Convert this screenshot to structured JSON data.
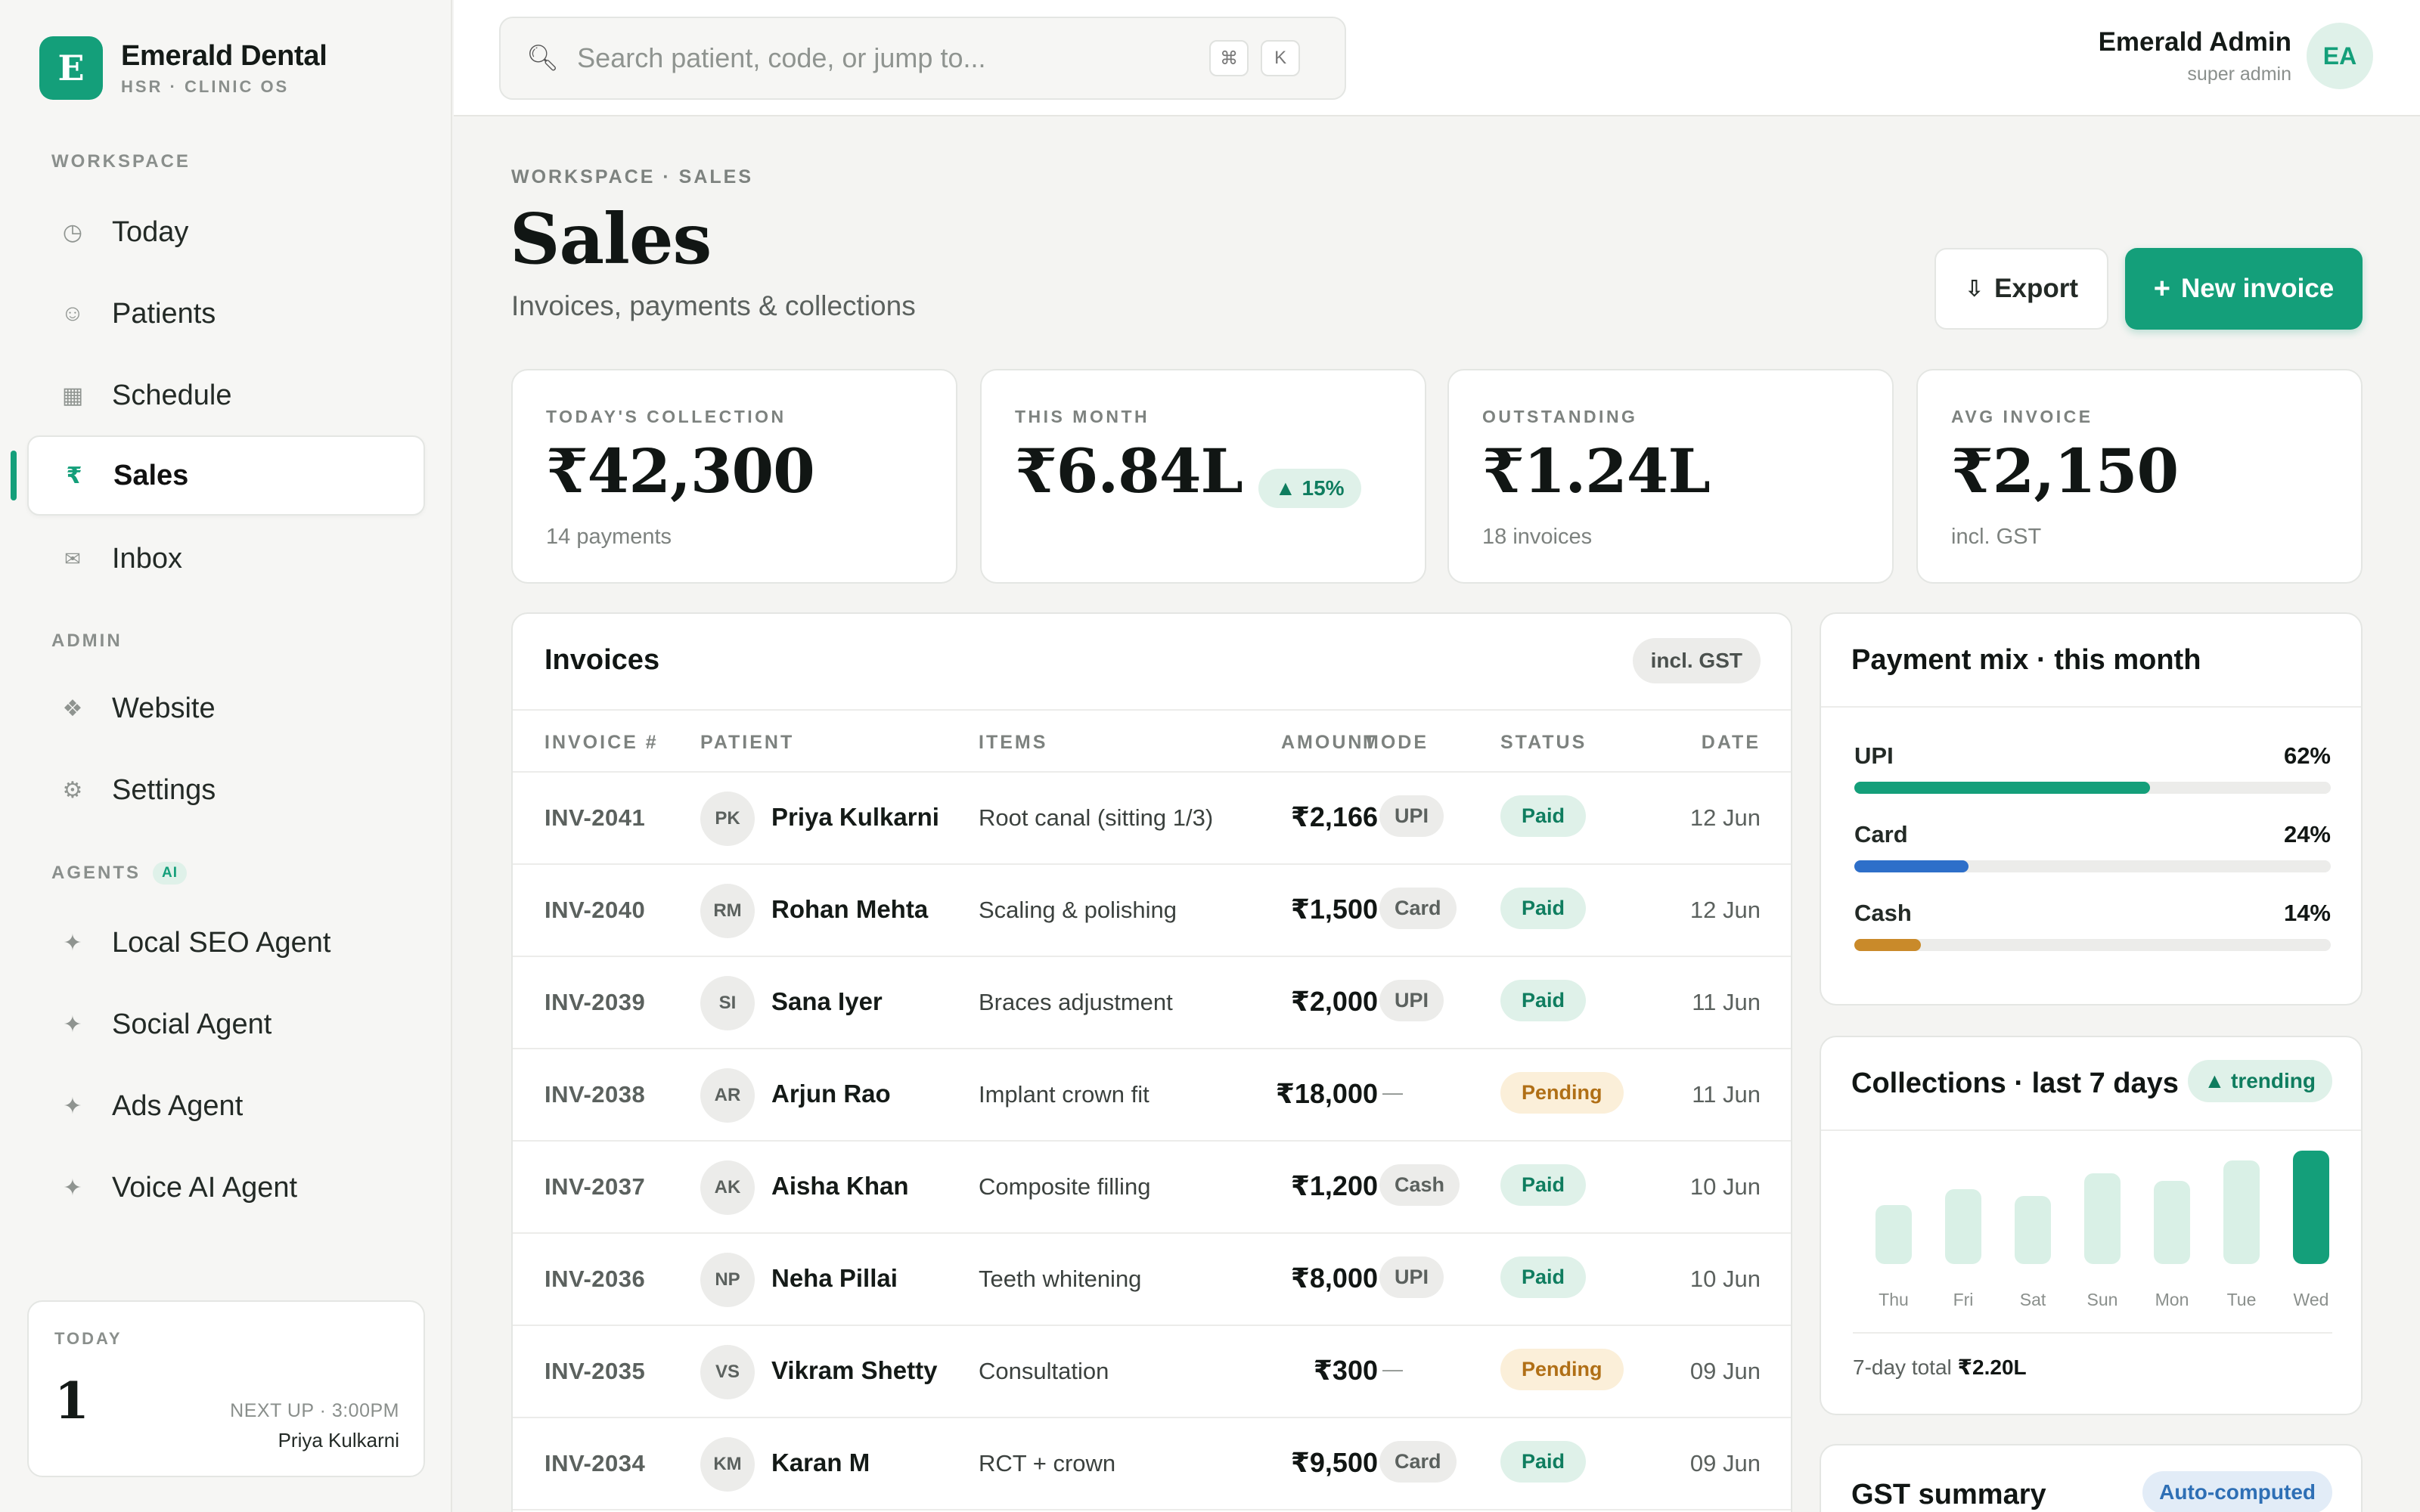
{
  "brand": {
    "logo_letter": "E",
    "name": "Emerald Dental",
    "subtitle": "HSR · CLINIC OS"
  },
  "sidebar": {
    "sections": {
      "workspace": "WORKSPACE",
      "admin": "ADMIN",
      "agents": "AGENTS",
      "agents_badge": "AI"
    },
    "workspace_items": [
      {
        "label": "Today",
        "icon": "clock-icon"
      },
      {
        "label": "Patients",
        "icon": "smiley-icon"
      },
      {
        "label": "Schedule",
        "icon": "calendar-grid-icon"
      },
      {
        "label": "Sales",
        "icon": "rupee-icon",
        "active": true
      },
      {
        "label": "Inbox",
        "icon": "envelope-icon"
      }
    ],
    "admin_items": [
      {
        "label": "Website",
        "icon": "diamond-icon"
      },
      {
        "label": "Settings",
        "icon": "gear-icon"
      }
    ],
    "agent_items": [
      {
        "label": "Local SEO Agent",
        "icon": "sparkle-icon"
      },
      {
        "label": "Social Agent",
        "icon": "sparkle-icon"
      },
      {
        "label": "Ads Agent",
        "icon": "sparkle-icon"
      },
      {
        "label": "Voice AI Agent",
        "icon": "sparkle-icon"
      }
    ],
    "today_card": {
      "label": "TODAY",
      "count": "1",
      "next_up": "NEXT UP · 3:00PM",
      "next_patient": "Priya Kulkarni"
    }
  },
  "topbar": {
    "search_placeholder": "Search patient, code, or jump to...",
    "shortcut_keys": [
      "⌘",
      "K"
    ],
    "user_name": "Emerald Admin",
    "user_role": "super admin",
    "user_initials": "EA"
  },
  "header": {
    "breadcrumb": "WORKSPACE · SALES",
    "title": "Sales",
    "subtitle": "Invoices, payments & collections",
    "export_label": "Export",
    "new_invoice_label": "New invoice"
  },
  "stats": [
    {
      "label": "TODAY'S COLLECTION",
      "value": "₹42,300",
      "sub": "14 payments"
    },
    {
      "label": "THIS MONTH",
      "value": "₹6.84L",
      "delta": "▲ 15%"
    },
    {
      "label": "OUTSTANDING",
      "value": "₹1.24L",
      "sub": "18 invoices"
    },
    {
      "label": "AVG INVOICE",
      "value": "₹2,150",
      "sub": "incl. GST"
    }
  ],
  "invoices": {
    "title": "Invoices",
    "badge": "incl. GST",
    "columns": [
      "INVOICE #",
      "PATIENT",
      "ITEMS",
      "AMOUNT",
      "MODE",
      "STATUS",
      "DATE"
    ],
    "rows": [
      {
        "id": "INV-2041",
        "initials": "PK",
        "patient": "Priya Kulkarni",
        "items": "Root canal (sitting 1/3)",
        "amount": "₹2,166",
        "mode": "UPI",
        "status": "Paid",
        "date": "12 Jun"
      },
      {
        "id": "INV-2040",
        "initials": "RM",
        "patient": "Rohan Mehta",
        "items": "Scaling & polishing",
        "amount": "₹1,500",
        "mode": "Card",
        "status": "Paid",
        "date": "12 Jun"
      },
      {
        "id": "INV-2039",
        "initials": "SI",
        "patient": "Sana Iyer",
        "items": "Braces adjustment",
        "amount": "₹2,000",
        "mode": "UPI",
        "status": "Paid",
        "date": "11 Jun"
      },
      {
        "id": "INV-2038",
        "initials": "AR",
        "patient": "Arjun Rao",
        "items": "Implant crown fit",
        "amount": "₹18,000",
        "mode": "—",
        "status": "Pending",
        "date": "11 Jun"
      },
      {
        "id": "INV-2037",
        "initials": "AK",
        "patient": "Aisha Khan",
        "items": "Composite filling",
        "amount": "₹1,200",
        "mode": "Cash",
        "status": "Paid",
        "date": "10 Jun"
      },
      {
        "id": "INV-2036",
        "initials": "NP",
        "patient": "Neha Pillai",
        "items": "Teeth whitening",
        "amount": "₹8,000",
        "mode": "UPI",
        "status": "Paid",
        "date": "10 Jun"
      },
      {
        "id": "INV-2035",
        "initials": "VS",
        "patient": "Vikram Shetty",
        "items": "Consultation",
        "amount": "₹300",
        "mode": "—",
        "status": "Pending",
        "date": "09 Jun"
      },
      {
        "id": "INV-2034",
        "initials": "KM",
        "patient": "Karan M",
        "items": "RCT + crown",
        "amount": "₹9,500",
        "mode": "Card",
        "status": "Paid",
        "date": "09 Jun"
      }
    ]
  },
  "payment_mix": {
    "title": "Payment mix · this month",
    "items": [
      {
        "label": "UPI",
        "pct_label": "62%",
        "pct": 62,
        "color": "#149f7a"
      },
      {
        "label": "Card",
        "pct_label": "24%",
        "pct": 24,
        "color": "#2e6fc9"
      },
      {
        "label": "Cash",
        "pct_label": "14%",
        "pct": 14,
        "color": "#c98a2a"
      }
    ]
  },
  "collections": {
    "title": "Collections · last 7 days",
    "trend": "▲ trending",
    "total_label": "7-day total",
    "total_value": "₹2.20L",
    "days": [
      "Thu",
      "Fri",
      "Sat",
      "Sun",
      "Mon",
      "Tue",
      "Wed"
    ],
    "relative_heights": [
      0.52,
      0.66,
      0.6,
      0.8,
      0.73,
      0.91,
      1.0
    ],
    "colors": {
      "bar": "#d9f0e6",
      "today": "#149f7a"
    }
  },
  "gst_summary": {
    "title": "GST summary",
    "badge": "Auto-computed"
  },
  "colors": {
    "accent": "#149f7a",
    "paid_bg": "#dff1e9",
    "pending_bg": "#fbefd9"
  }
}
